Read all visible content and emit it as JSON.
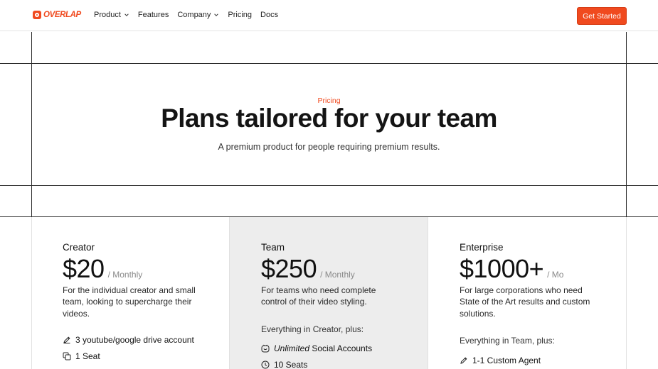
{
  "nav": {
    "logo_text": "OVERLAP",
    "items": [
      {
        "label": "Product",
        "has_dropdown": true
      },
      {
        "label": "Features",
        "has_dropdown": false
      },
      {
        "label": "Company",
        "has_dropdown": true
      },
      {
        "label": "Pricing",
        "has_dropdown": false
      },
      {
        "label": "Docs",
        "has_dropdown": false
      }
    ],
    "cta_label": "Get Started"
  },
  "hero": {
    "eyebrow": "Pricing",
    "title": "Plans tailored for your team",
    "subtitle": "A premium product for people requiring premium results."
  },
  "plans": [
    {
      "name": "Creator",
      "price": "$20",
      "period": "/ Monthly",
      "description": "For the individual creator and small team, looking to supercharge their videos.",
      "features": [
        {
          "icon": "pen-icon",
          "label": "3 youtube/google drive account"
        },
        {
          "icon": "copy-icon",
          "label": "1 Seat"
        }
      ]
    },
    {
      "name": "Team",
      "price": "$250",
      "period": "/ Monthly",
      "description": "For teams who need complete control of their video styling.",
      "everything": "Everything in Creator, plus:",
      "features": [
        {
          "icon": "smile-box-icon",
          "emphasis": "Unlimited",
          "label": " Social Accounts"
        },
        {
          "icon": "clock-icon",
          "label": "10 Seats"
        }
      ]
    },
    {
      "name": "Enterprise",
      "price": "$1000+",
      "period": "/ Mo",
      "description": "For large corporations who need State of the Art results and custom solutions.",
      "everything": "Everything in Team, plus:",
      "features": [
        {
          "icon": "pen-icon",
          "label": "1-1 Custom Agent"
        }
      ]
    }
  ],
  "colors": {
    "accent": "#f04a1f",
    "team_bg": "#ededed",
    "grid_line": "#2a2a2a"
  }
}
